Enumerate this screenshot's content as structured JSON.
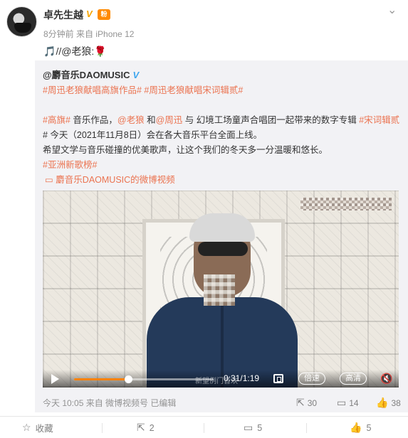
{
  "post": {
    "username": "卓先生越",
    "verified_mark": "V",
    "level_badge": "粉",
    "time": "8分钟前",
    "source": "来自 iPhone 12",
    "text_prefix": "🎵",
    "text": "//@老狼:",
    "text_suffix": "🌹"
  },
  "repost": {
    "author": "@麝音乐DAOMUSIC",
    "author_badge": "V",
    "tag_line": "#周迅老狼献唱高旗作品# #周迅老狼献唱宋词辑贰#",
    "body_line1_tag": "#高旗#",
    "body_line1_text": " 音乐作品，",
    "body_line1_mention1": "@老狼",
    "body_line1_and": " 和",
    "body_line1_mention2": "@周迅",
    "body_line1_rest": " 与 幻境工场童声合唱团一起带来的数字专辑 ",
    "body_line1_tag2": "#宋词辑贰",
    "body_line2": "# 今天（2021年11月8日）会在各大音乐平台全面上线。",
    "body_line3": "希望文学与音乐碰撞的优美歌声，让这个我们的冬天多一分温暖和悠长。",
    "body_line4_tag": "#亚洲新歌榜#",
    "video_link": "麝音乐DAOMUSIC的微博视频",
    "video": {
      "time": "0:31/1:19",
      "progress": 0.39,
      "speed_label": "倍速",
      "quality_label": "高清",
      "watermark": "新望例门音欢"
    },
    "footer_meta": "今天 10:05 来自 微博视频号  已编辑",
    "repost_count": "30",
    "comment_count": "14",
    "like_count": "38"
  },
  "actions": {
    "favorite_label": "收藏",
    "repost_count": "2",
    "comment_count": "5",
    "like_count": "5"
  }
}
